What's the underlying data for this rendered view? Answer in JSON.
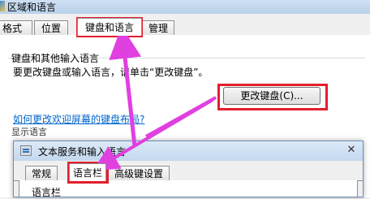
{
  "window": {
    "title": "区域和语言"
  },
  "tabs": [
    {
      "label": "格式"
    },
    {
      "label": "位置"
    },
    {
      "label": "键盘和语言"
    },
    {
      "label": "管理"
    }
  ],
  "keyboard_section": {
    "group_title": "键盘和其他输入语言",
    "info_text": "要更改键盘或输入语言，请单击“更改键盘”。",
    "change_button": "更改键盘(C)...",
    "help_link": "如何更改欢迎屏幕的键盘布局?",
    "next_group_title": "显示语言"
  },
  "dialog": {
    "title": "文本服务和输入语言",
    "close_glyph": "✕",
    "tabs": [
      {
        "label": "常规"
      },
      {
        "label": "语言栏"
      },
      {
        "label": "高级键设置"
      }
    ],
    "group_title": "语言栏"
  },
  "colors": {
    "highlight": "#e31e2e",
    "arrow": "#e040e0",
    "link": "#0066cc"
  },
  "icons": {
    "window": "window-app-icon",
    "dialog": "keyboard-icon",
    "close": "close-icon"
  }
}
